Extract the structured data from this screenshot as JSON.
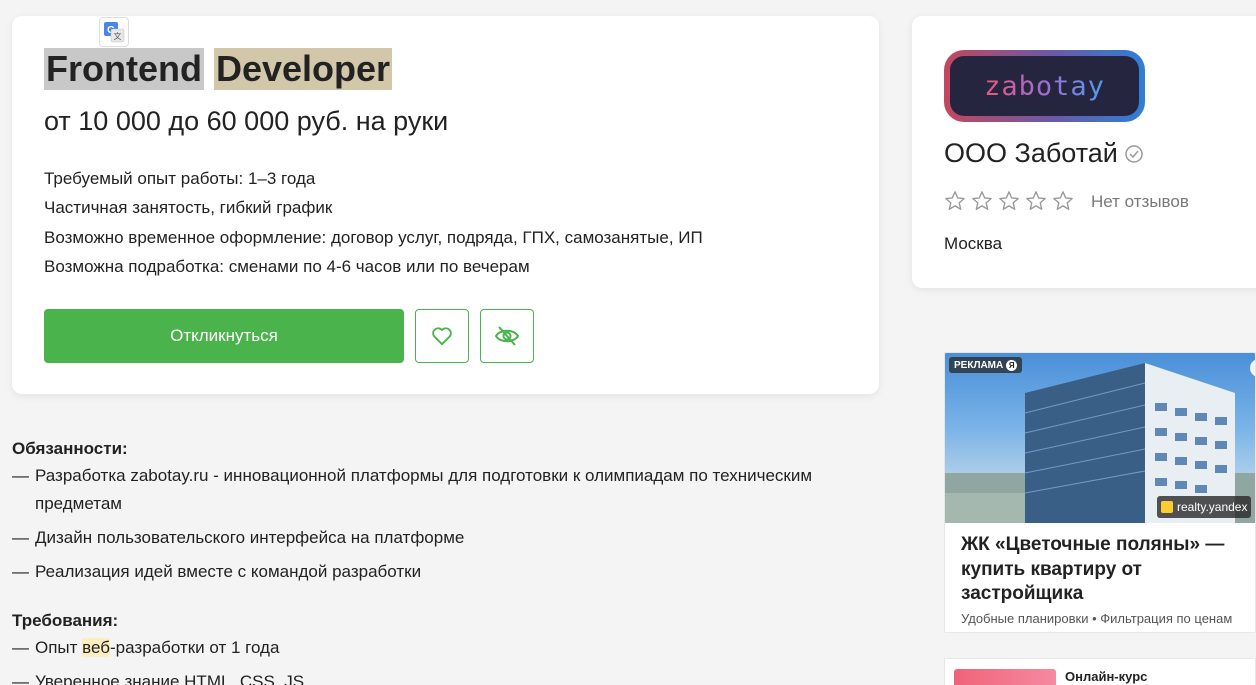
{
  "vacancy": {
    "title_part1": "Frontend",
    "title_part2": "Developer",
    "salary": "от 10 000 до 60 000 руб. на руки",
    "conditions": [
      "Требуемый опыт работы: 1–3 года",
      "Частичная занятость, гибкий график",
      "Возможно временное оформление: договор услуг, подряда, ГПХ, самозанятые, ИП",
      "Возможна подработка: сменами по 4-6 часов или по вечерам"
    ],
    "apply_label": "Откликнуться",
    "favorite_icon": "heart-icon",
    "hide_icon": "eye-off-icon",
    "translate_icon": "google-translate-icon"
  },
  "description": {
    "duties_heading": "Обязанности:",
    "duties": [
      "Разработка zabotay.ru - инновационной платформы для подготовки к олимпиадам по техническим предметам",
      "Дизайн пользовательского интерфейса на платформе",
      "Реализация идей вместе с командой разработки"
    ],
    "requirements_heading": "Требования:",
    "req1_prefix": "Опыт ",
    "req1_highlight": "веб",
    "req1_suffix": "-разработки от 1 года",
    "req2": "Уверенное знание HTML, CSS, JS"
  },
  "company": {
    "logo_text": "zabotay",
    "name": "ООО Заботай",
    "verified_icon": "check-circle-icon",
    "rating_stars": 0,
    "rating_max": 5,
    "reviews_text": "Нет отзывов",
    "city": "Москва"
  },
  "ad": {
    "badge": "РЕКЛАМА",
    "badge_logo": "Я",
    "source": "realty.yandex",
    "title": "ЖК «Цветочные поляны» — купить квартиру от застройщика",
    "subtitle": "Удобные планировки • Фильтрация по ценам"
  },
  "course": {
    "label": "Онлайн-курс"
  },
  "colors": {
    "accent_green": "#4bb34b",
    "title_highlight_1": "#c8c8c8",
    "title_highlight_2": "#d2c7a9",
    "word_highlight": "#fbeec1"
  }
}
